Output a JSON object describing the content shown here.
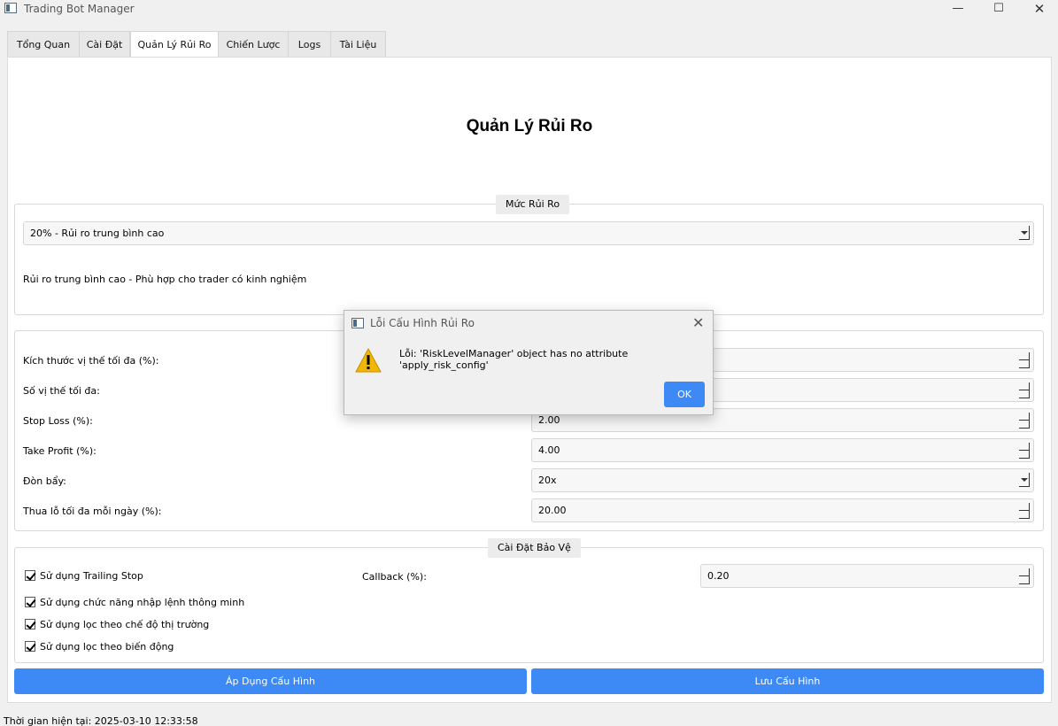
{
  "window": {
    "title": "Trading Bot Manager",
    "minimize_glyph": "—",
    "maximize_glyph": "☐",
    "close_glyph": "✕"
  },
  "tabs": [
    {
      "label": "Tổng Quan"
    },
    {
      "label": "Cài Đặt"
    },
    {
      "label": "Quản Lý Rủi Ro",
      "active": true
    },
    {
      "label": "Chiến Lược"
    },
    {
      "label": "Logs"
    },
    {
      "label": "Tài Liệu"
    }
  ],
  "page": {
    "title": "Quản Lý Rủi Ro"
  },
  "risk_level": {
    "group_title": "Mức Rủi Ro",
    "selected": "20% - Rủi ro trung bình cao",
    "description": "Rủi ro trung bình cao - Phù hợp cho trader có kinh nghiệm"
  },
  "settings": {
    "max_position_size_label": "Kích thước vị thế tối đa (%):",
    "max_positions_label": "Số vị thế tối đa:",
    "stop_loss_label": "Stop Loss (%):",
    "stop_loss_value": "2.00",
    "take_profit_label": "Take Profit (%):",
    "take_profit_value": "4.00",
    "leverage_label": "Đòn bẩy:",
    "leverage_value": "20x",
    "max_daily_loss_label": "Thua lỗ tối đa mỗi ngày (%):",
    "max_daily_loss_value": "20.00"
  },
  "protection": {
    "group_title": "Cài Đặt Bảo Vệ",
    "trailing_stop_label": "Sử dụng Trailing Stop",
    "trailing_stop_checked": true,
    "callback_label": "Callback (%):",
    "callback_value": "0.20",
    "smart_entry_label": "Sử dụng chức năng nhập lệnh thông minh",
    "smart_entry_checked": true,
    "market_regime_filter_label": "Sử dụng lọc theo chế độ thị trường",
    "market_regime_filter_checked": true,
    "volatility_filter_label": "Sử dụng lọc theo biến động",
    "volatility_filter_checked": true
  },
  "actions": {
    "apply_label": "Áp Dụng Cấu Hình",
    "save_label": "Lưu Cấu Hình"
  },
  "status_bar": {
    "text": "Thời gian hiện tại: 2025-03-10 12:33:58"
  },
  "dialog": {
    "title": "Lỗi Cấu Hình Rủi Ro",
    "message": "Lỗi: 'RiskLevelManager' object has no attribute 'apply_risk_config'",
    "ok_label": "OK",
    "close_glyph": "✕",
    "icon": "warning-icon"
  },
  "colors": {
    "accent": "#3d89f5",
    "warning": "#f2b705"
  }
}
